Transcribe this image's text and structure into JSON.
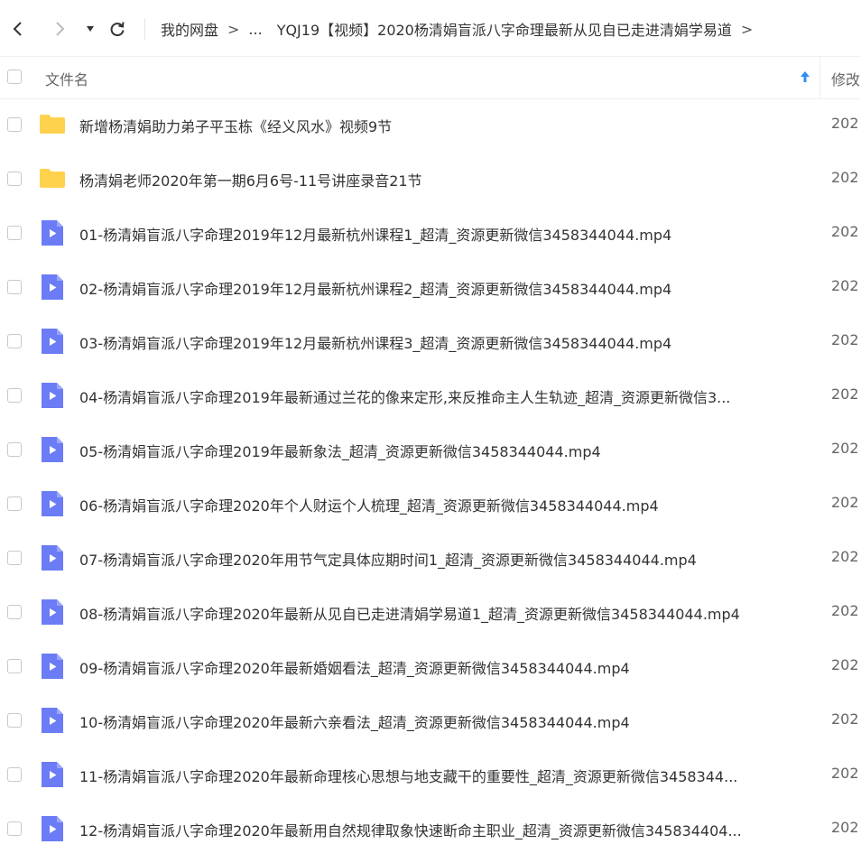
{
  "nav": {
    "breadcrumb": {
      "root": "我的网盘",
      "sep1": ">",
      "ellipsis": "...",
      "current": "YQJ19【视频】2020杨清娟盲派八字命理最新从见自已走进清娟学易道",
      "sep2": ">"
    }
  },
  "columns": {
    "name": "文件名",
    "modified": "修改"
  },
  "colors": {
    "folder": "#ffd24d",
    "video": "#6b7cf6",
    "sort_arrow": "#2d8cf0"
  },
  "files": [
    {
      "type": "folder",
      "name": "新增杨清娟助力弟子平玉栋《经义风水》视频9节",
      "date": "202"
    },
    {
      "type": "folder",
      "name": "杨清娟老师2020年第一期6月6号-11号讲座录音21节",
      "date": "202"
    },
    {
      "type": "video",
      "name": "01-杨清娟盲派八字命理2019年12月最新杭州课程1_超清_资源更新微信3458344044.mp4",
      "date": "202"
    },
    {
      "type": "video",
      "name": "02-杨清娟盲派八字命理2019年12月最新杭州课程2_超清_资源更新微信3458344044.mp4",
      "date": "202"
    },
    {
      "type": "video",
      "name": "03-杨清娟盲派八字命理2019年12月最新杭州课程3_超清_资源更新微信3458344044.mp4",
      "date": "202"
    },
    {
      "type": "video",
      "name": "04-杨清娟盲派八字命理2019年最新通过兰花的像来定形,来反推命主人生轨迹_超清_资源更新微信3...",
      "date": "202"
    },
    {
      "type": "video",
      "name": "05-杨清娟盲派八字命理2019年最新象法_超清_资源更新微信3458344044.mp4",
      "date": "202"
    },
    {
      "type": "video",
      "name": "06-杨清娟盲派八字命理2020年个人财运个人梳理_超清_资源更新微信3458344044.mp4",
      "date": "202"
    },
    {
      "type": "video",
      "name": "07-杨清娟盲派八字命理2020年用节气定具体应期时间1_超清_资源更新微信3458344044.mp4",
      "date": "202"
    },
    {
      "type": "video",
      "name": "08-杨清娟盲派八字命理2020年最新从见自已走进清娟学易道1_超清_资源更新微信3458344044.mp4",
      "date": "202"
    },
    {
      "type": "video",
      "name": "09-杨清娟盲派八字命理2020年最新婚姻看法_超清_资源更新微信3458344044.mp4",
      "date": "202"
    },
    {
      "type": "video",
      "name": "10-杨清娟盲派八字命理2020年最新六亲看法_超清_资源更新微信3458344044.mp4",
      "date": "202"
    },
    {
      "type": "video",
      "name": "11-杨清娟盲派八字命理2020年最新命理核心思想与地支藏干的重要性_超清_资源更新微信3458344...",
      "date": "202"
    },
    {
      "type": "video",
      "name": "12-杨清娟盲派八字命理2020年最新用自然规律取象快速断命主职业_超清_资源更新微信345834404...",
      "date": "202"
    }
  ]
}
